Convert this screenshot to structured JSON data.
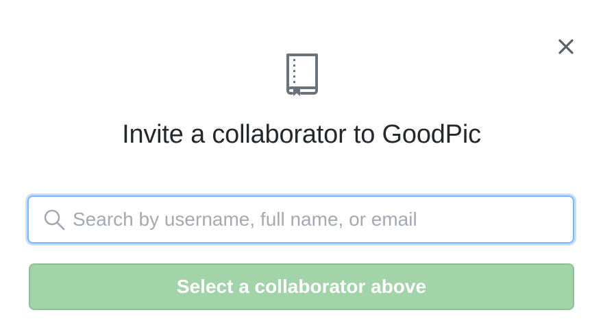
{
  "dialog": {
    "close_icon": "close-icon",
    "repo_icon": "repo-book-icon",
    "title": "Invite a collaborator to GoodPic",
    "search": {
      "icon": "search-icon",
      "placeholder": "Search by username, full name, or email",
      "value": ""
    },
    "submit": {
      "label": "Select a collaborator above",
      "disabled": true
    }
  },
  "colors": {
    "title_text": "#24292e",
    "icon_gray": "#6a737d",
    "focus_border": "#79b8ff",
    "button_bg_disabled": "#a2d3a9",
    "button_text": "#ffffff",
    "placeholder": "#a3aab1"
  }
}
